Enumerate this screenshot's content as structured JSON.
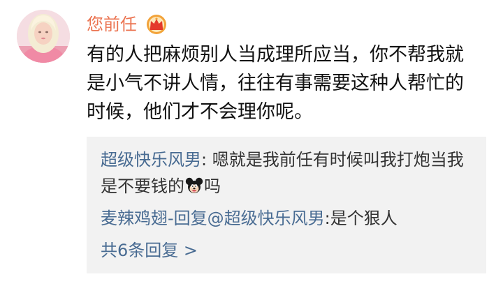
{
  "comment": {
    "username": "您前任",
    "badge_icon": "crown-badge-icon",
    "text": "有的人把麻烦别人当成理所应当，你不帮我就是小气不讲人情，往往有事需要这种人帮忙的时候，他们才不会理你呢。"
  },
  "replies": [
    {
      "author": "超级快乐风男",
      "separator": ": ",
      "text_before_emoji": "嗯就是我前任有时候叫我打炮当我是不要钱的",
      "emoji": "mickey-mouse-emoji-icon",
      "text_after_emoji": "吗"
    },
    {
      "author": "麦辣鸡翅",
      "reply_label": "-回复",
      "mention": "@超级快乐风男",
      "separator": ":",
      "text": "是个狠人"
    }
  ],
  "more_replies_label": "共6条回复 >",
  "colors": {
    "username": "#eb7350",
    "link": "#486b92",
    "reply_background": "#f2f2f2",
    "text": "#111111"
  }
}
